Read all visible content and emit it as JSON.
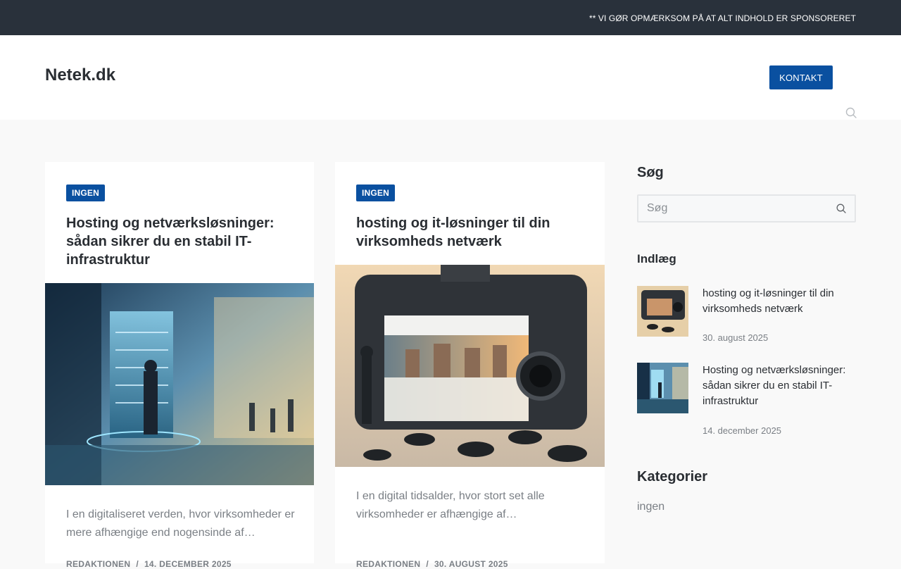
{
  "topbar": {
    "notice": "** VI GØR OPMÆRKSOM PÅ AT ALT INDHOLD ER SPONSORERET"
  },
  "header": {
    "site_title": "Netek.dk",
    "contact_label": "KONTAKT",
    "search_icon": "search-icon"
  },
  "posts": [
    {
      "category": "INGEN",
      "title": "Hosting og netværksløsninger: sådan sikrer du en stabil IT-infrastruktur",
      "excerpt": "I en digitaliseret verden, hvor virksomheder er mere afhængige end nogensinde af…",
      "author": "REDAKTIONEN",
      "separator": "/",
      "date": "14. DECEMBER 2025"
    },
    {
      "category": "INGEN",
      "title": "hosting og it-løsninger til din virksomheds netværk",
      "excerpt": "I en digital tidsalder, hvor stort set alle virksomheder er afhængige af…",
      "author": "REDAKTIONEN",
      "separator": "/",
      "date": "30. AUGUST 2025"
    }
  ],
  "sidebar": {
    "search_title": "Søg",
    "search_placeholder": "Søg",
    "posts_title": "Indlæg",
    "recent_posts": [
      {
        "title": "hosting og it-løsninger til din virksomheds netværk",
        "date": "30. august 2025"
      },
      {
        "title": "Hosting og netværksløsninger: sådan sikrer du en stabil IT-infrastruktur",
        "date": "14. december 2025"
      }
    ],
    "categories_title": "Kategorier",
    "categories": [
      "ingen"
    ]
  },
  "colors": {
    "topbar_bg": "#29313b",
    "accent": "#0a50a0",
    "page_bg": "#f9f9f9",
    "text_muted": "#7a7f85"
  }
}
